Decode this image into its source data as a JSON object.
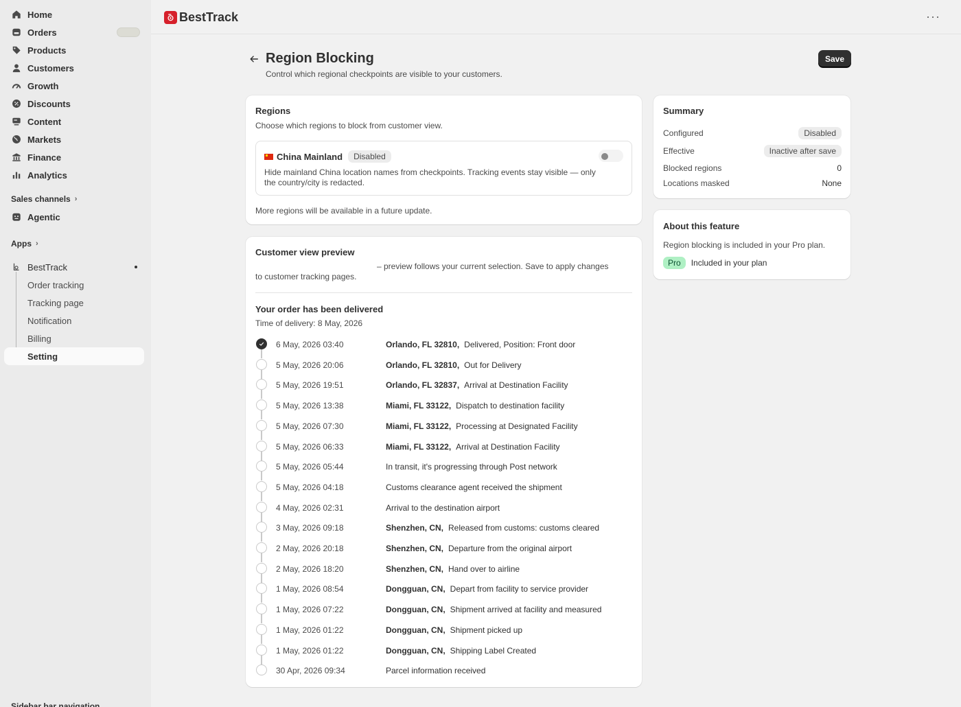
{
  "sidebar": {
    "nav": [
      {
        "label": "Home",
        "icon": "home-icon"
      },
      {
        "label": "Orders",
        "icon": "orders-icon"
      },
      {
        "label": "Products",
        "icon": "tag-icon"
      },
      {
        "label": "Customers",
        "icon": "person-icon"
      },
      {
        "label": "Growth",
        "icon": "gauge-icon"
      },
      {
        "label": "Discounts",
        "icon": "discount-icon"
      },
      {
        "label": "Content",
        "icon": "content-icon"
      },
      {
        "label": "Markets",
        "icon": "globe-icon"
      },
      {
        "label": "Finance",
        "icon": "bank-icon"
      },
      {
        "label": "Analytics",
        "icon": "bar-chart-icon"
      }
    ],
    "sales_channels_label": "Sales channels",
    "agentic_label": "Agentic",
    "apps_label": "Apps",
    "app_name": "BestTrack",
    "app_subitems": [
      "Order tracking",
      "Tracking page",
      "Notification",
      "Billing",
      "Setting"
    ],
    "active_subitem": "Setting",
    "bottom_text": "Sidebar bar navigation"
  },
  "topbar": {
    "brand": "BestTrack",
    "more": "···"
  },
  "header": {
    "title": "Region Blocking",
    "subtitle": "Control which regional checkpoints are visible to your customers.",
    "save_label": "Save"
  },
  "regions": {
    "title": "Regions",
    "subtitle": "Choose which regions to block from customer view.",
    "region_name": "China Mainland",
    "region_status": "Disabled",
    "region_desc": "Hide mainland China location names from checkpoints. Tracking events stay visible — only the country/city is redacted.",
    "toggle_on": false,
    "footer": "More regions will be available in a future update."
  },
  "preview": {
    "title": "Customer view preview",
    "note": "– preview follows your current selection. Save to apply changes to customer tracking pages.",
    "delivered_title": "Your order has been delivered",
    "delivered_time": "Time of delivery: 8 May, 2026",
    "events": [
      {
        "date": "6 May, 2026 03:40",
        "location": "Orlando, FL 32810,",
        "desc": "Delivered, Position: Front door",
        "done": true
      },
      {
        "date": "5 May, 2026 20:06",
        "location": "Orlando, FL 32810,",
        "desc": "Out for Delivery"
      },
      {
        "date": "5 May, 2026 19:51",
        "location": "Orlando, FL 32837,",
        "desc": "Arrival at Destination Facility"
      },
      {
        "date": "5 May, 2026 13:38",
        "location": "Miami, FL 33122,",
        "desc": "Dispatch to destination facility"
      },
      {
        "date": "5 May, 2026 07:30",
        "location": "Miami, FL 33122,",
        "desc": "Processing at Designated Facility"
      },
      {
        "date": "5 May, 2026 06:33",
        "location": "Miami, FL 33122,",
        "desc": "Arrival at Destination Facility"
      },
      {
        "date": "5 May, 2026 05:44",
        "location": "",
        "desc": "In transit, it's progressing through Post network"
      },
      {
        "date": "5 May, 2026 04:18",
        "location": "",
        "desc": "Customs clearance agent received the shipment"
      },
      {
        "date": "4 May, 2026 02:31",
        "location": "",
        "desc": "Arrival to the destination airport"
      },
      {
        "date": "3 May, 2026 09:18",
        "location": "Shenzhen, CN,",
        "desc": "Released from customs: customs cleared"
      },
      {
        "date": "2 May, 2026 20:18",
        "location": "Shenzhen, CN,",
        "desc": "Departure from the original airport"
      },
      {
        "date": "2 May, 2026 18:20",
        "location": "Shenzhen, CN,",
        "desc": "Hand over to airline"
      },
      {
        "date": "1 May, 2026 08:54",
        "location": "Dongguan, CN,",
        "desc": "Depart from facility to service provider"
      },
      {
        "date": "1 May, 2026 07:22",
        "location": "Dongguan, CN,",
        "desc": "Shipment arrived at facility and measured"
      },
      {
        "date": "1 May, 2026 01:22",
        "location": "Dongguan, CN,",
        "desc": "Shipment picked up"
      },
      {
        "date": "1 May, 2026 01:22",
        "location": "Dongguan, CN,",
        "desc": "Shipping Label Created"
      },
      {
        "date": "30 Apr, 2026 09:34",
        "location": "",
        "desc": "Parcel information received"
      }
    ]
  },
  "summary": {
    "title": "Summary",
    "rows": [
      {
        "label": "Configured",
        "value": "Disabled"
      },
      {
        "label": "Effective",
        "value": "Inactive after save"
      },
      {
        "label": "Blocked regions",
        "value": "0"
      },
      {
        "label": "Locations masked",
        "value": "None"
      }
    ]
  },
  "about": {
    "title": "About this feature",
    "text": "Region blocking is included in your Pro plan.",
    "plan_badge": "Pro",
    "plan_text": "Included in your plan"
  },
  "colors": {
    "brand": "#d6202b",
    "primary_button": "#303030",
    "pro_badge_bg": "#aff0c4"
  }
}
